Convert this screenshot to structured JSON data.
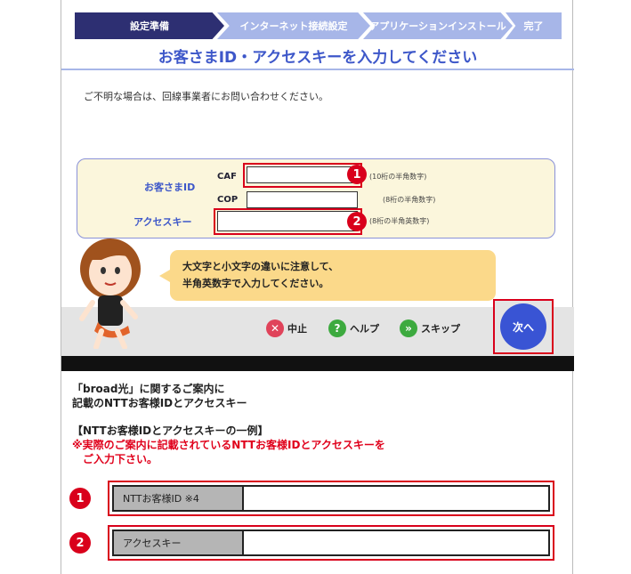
{
  "steps": [
    "設定準備",
    "インターネット接続設定",
    "アプリケーションインストール",
    "完了"
  ],
  "title": "お客さまID・アクセスキーを入力してください",
  "note": "ご不明な場合は、回線事業者にお問い合わせください。",
  "form": {
    "label_id": "お客さまID",
    "label_caf": "CAF",
    "label_cop": "COP",
    "label_accesskey": "アクセスキー",
    "hint_caf": "(10桁の半角数字)",
    "hint_cop": "(8桁の半角数字)",
    "hint_accesskey": "(8桁の半角英数字)",
    "value_caf": "",
    "value_cop": "",
    "value_accesskey": ""
  },
  "bubble": {
    "line1": "大文字と小文字の違いに注意して、",
    "line2": "半角英数字で入力してください。"
  },
  "actions": {
    "stop": "中止",
    "help": "ヘルプ",
    "skip": "スキップ",
    "next": "次へ"
  },
  "info": {
    "line1": "「broad光」に関するご案内に",
    "line2": "記載のNTTお客様IDとアクセスキー",
    "example": "【NTTお客様IDとアクセスキーの一例】",
    "warn1": "※実際のご案内に記載されているNTTお客様IDとアクセスキーを",
    "warn2": "ご入力下さい。"
  },
  "example_rows": [
    {
      "num": "1",
      "label": "NTTお客様ID ※4",
      "value": ""
    },
    {
      "num": "2",
      "label": "アクセスキー",
      "value": ""
    }
  ],
  "badges": [
    "1",
    "2"
  ],
  "colors": {
    "accent": "#3d57c9",
    "highlight": "#d9001b",
    "step_active": "#2d2f72",
    "step_inactive": "#a7b6e8"
  }
}
